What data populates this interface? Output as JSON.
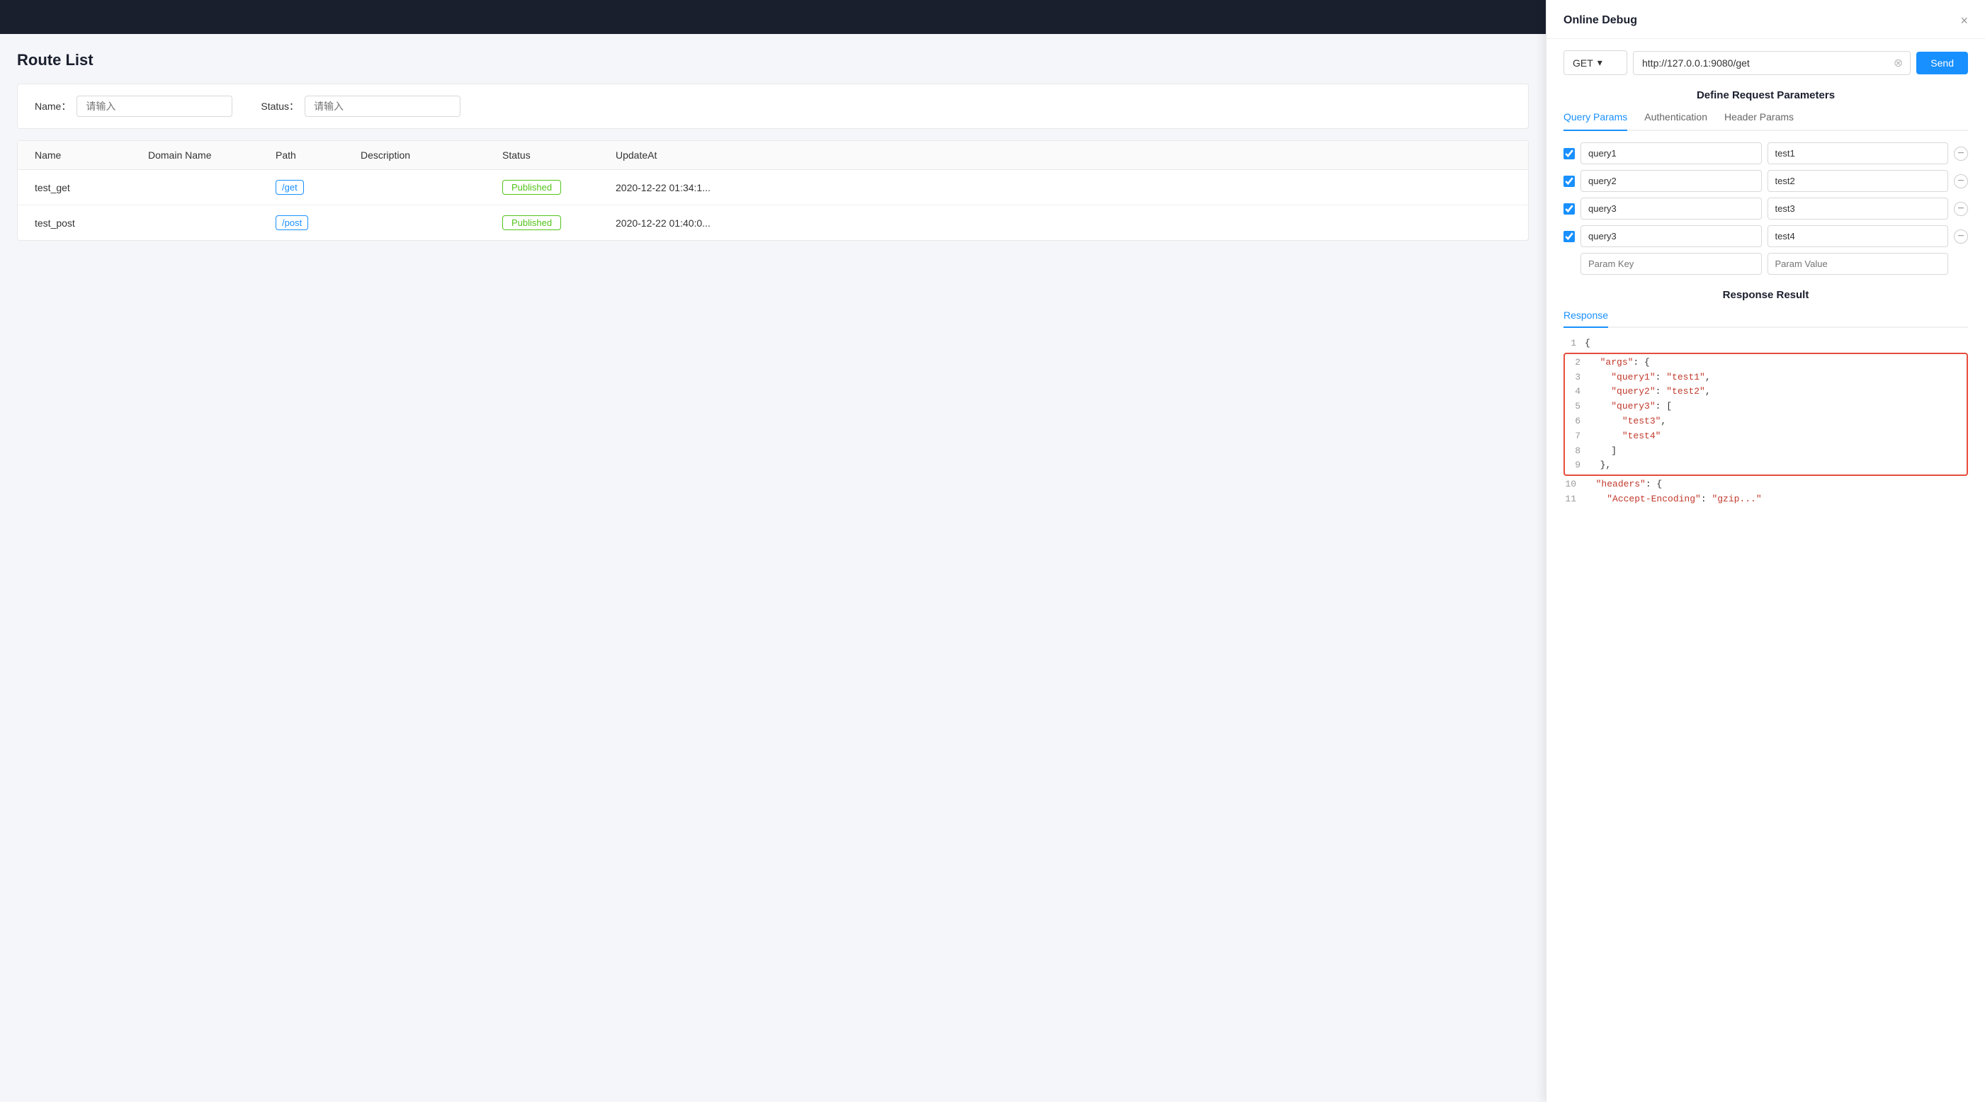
{
  "topBar": {},
  "leftPanel": {
    "pageTitle": "Route List",
    "filters": {
      "nameLabel": "Name：",
      "namePlaceholder": "请输入",
      "statusLabel": "Status：",
      "statusPlaceholder": "请输入"
    },
    "table": {
      "columns": [
        "Name",
        "Domain Name",
        "Path",
        "Description",
        "Status",
        "UpdateAt"
      ],
      "rows": [
        {
          "name": "test_get",
          "domainName": "",
          "path": "/get",
          "description": "",
          "status": "Published",
          "updateAt": "2020-12-22 01:34:1..."
        },
        {
          "name": "test_post",
          "domainName": "",
          "path": "/post",
          "description": "",
          "status": "Published",
          "updateAt": "2020-12-22 01:40:0..."
        }
      ]
    }
  },
  "rightPanel": {
    "title": "Online Debug",
    "closeIcon": "×",
    "urlBar": {
      "method": "GET",
      "url": "http://127.0.0.1:9080/get",
      "sendLabel": "Send"
    },
    "defineParams": {
      "sectionTitle": "Define Request Parameters",
      "tabs": [
        "Query Params",
        "Authentication",
        "Header Params"
      ],
      "activeTab": "Query Params",
      "params": [
        {
          "checked": true,
          "key": "query1",
          "value": "test1"
        },
        {
          "checked": true,
          "key": "query2",
          "value": "test2"
        },
        {
          "checked": true,
          "key": "query3",
          "value": "test3"
        },
        {
          "checked": true,
          "key": "query3",
          "value": "test4"
        }
      ],
      "paramKeyPlaceholder": "Param Key",
      "paramValuePlaceholder": "Param Value"
    },
    "response": {
      "sectionTitle": "Response Result",
      "activeTab": "Response",
      "codeLines": [
        {
          "ln": "1",
          "text": "{"
        },
        {
          "ln": "2",
          "text": "  \"args\": {",
          "hasRedBorder": true
        },
        {
          "ln": "3",
          "text": "    \"query1\": \"test1\","
        },
        {
          "ln": "4",
          "text": "    \"query2\": \"test2\","
        },
        {
          "ln": "5",
          "text": "    \"query3\": ["
        },
        {
          "ln": "6",
          "text": "      \"test3\","
        },
        {
          "ln": "7",
          "text": "      \"test4\""
        },
        {
          "ln": "8",
          "text": "    ]"
        },
        {
          "ln": "9",
          "text": "},"
        },
        {
          "ln": "10",
          "text": "  \"headers\": {"
        },
        {
          "ln": "11",
          "text": "    \"Accept-Encoding\": \"gzip...\""
        }
      ]
    }
  }
}
